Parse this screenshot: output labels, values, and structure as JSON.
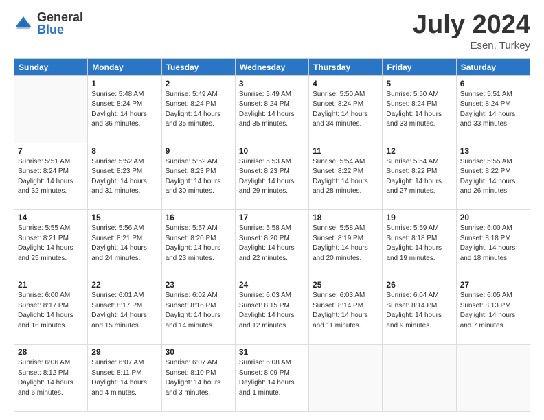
{
  "logo": {
    "general": "General",
    "blue": "Blue"
  },
  "title": "July 2024",
  "subtitle": "Esen, Turkey",
  "weekdays": [
    "Sunday",
    "Monday",
    "Tuesday",
    "Wednesday",
    "Thursday",
    "Friday",
    "Saturday"
  ],
  "weeks": [
    [
      {
        "day": null
      },
      {
        "day": "1",
        "sunrise": "5:48 AM",
        "sunset": "8:24 PM",
        "daylight": "14 hours and 36 minutes."
      },
      {
        "day": "2",
        "sunrise": "5:49 AM",
        "sunset": "8:24 PM",
        "daylight": "14 hours and 35 minutes."
      },
      {
        "day": "3",
        "sunrise": "5:49 AM",
        "sunset": "8:24 PM",
        "daylight": "14 hours and 35 minutes."
      },
      {
        "day": "4",
        "sunrise": "5:50 AM",
        "sunset": "8:24 PM",
        "daylight": "14 hours and 34 minutes."
      },
      {
        "day": "5",
        "sunrise": "5:50 AM",
        "sunset": "8:24 PM",
        "daylight": "14 hours and 33 minutes."
      },
      {
        "day": "6",
        "sunrise": "5:51 AM",
        "sunset": "8:24 PM",
        "daylight": "14 hours and 33 minutes."
      }
    ],
    [
      {
        "day": "7",
        "sunrise": "5:51 AM",
        "sunset": "8:24 PM",
        "daylight": "14 hours and 32 minutes."
      },
      {
        "day": "8",
        "sunrise": "5:52 AM",
        "sunset": "8:23 PM",
        "daylight": "14 hours and 31 minutes."
      },
      {
        "day": "9",
        "sunrise": "5:52 AM",
        "sunset": "8:23 PM",
        "daylight": "14 hours and 30 minutes."
      },
      {
        "day": "10",
        "sunrise": "5:53 AM",
        "sunset": "8:23 PM",
        "daylight": "14 hours and 29 minutes."
      },
      {
        "day": "11",
        "sunrise": "5:54 AM",
        "sunset": "8:22 PM",
        "daylight": "14 hours and 28 minutes."
      },
      {
        "day": "12",
        "sunrise": "5:54 AM",
        "sunset": "8:22 PM",
        "daylight": "14 hours and 27 minutes."
      },
      {
        "day": "13",
        "sunrise": "5:55 AM",
        "sunset": "8:22 PM",
        "daylight": "14 hours and 26 minutes."
      }
    ],
    [
      {
        "day": "14",
        "sunrise": "5:55 AM",
        "sunset": "8:21 PM",
        "daylight": "14 hours and 25 minutes."
      },
      {
        "day": "15",
        "sunrise": "5:56 AM",
        "sunset": "8:21 PM",
        "daylight": "14 hours and 24 minutes."
      },
      {
        "day": "16",
        "sunrise": "5:57 AM",
        "sunset": "8:20 PM",
        "daylight": "14 hours and 23 minutes."
      },
      {
        "day": "17",
        "sunrise": "5:58 AM",
        "sunset": "8:20 PM",
        "daylight": "14 hours and 22 minutes."
      },
      {
        "day": "18",
        "sunrise": "5:58 AM",
        "sunset": "8:19 PM",
        "daylight": "14 hours and 20 minutes."
      },
      {
        "day": "19",
        "sunrise": "5:59 AM",
        "sunset": "8:18 PM",
        "daylight": "14 hours and 19 minutes."
      },
      {
        "day": "20",
        "sunrise": "6:00 AM",
        "sunset": "8:18 PM",
        "daylight": "14 hours and 18 minutes."
      }
    ],
    [
      {
        "day": "21",
        "sunrise": "6:00 AM",
        "sunset": "8:17 PM",
        "daylight": "14 hours and 16 minutes."
      },
      {
        "day": "22",
        "sunrise": "6:01 AM",
        "sunset": "8:17 PM",
        "daylight": "14 hours and 15 minutes."
      },
      {
        "day": "23",
        "sunrise": "6:02 AM",
        "sunset": "8:16 PM",
        "daylight": "14 hours and 14 minutes."
      },
      {
        "day": "24",
        "sunrise": "6:03 AM",
        "sunset": "8:15 PM",
        "daylight": "14 hours and 12 minutes."
      },
      {
        "day": "25",
        "sunrise": "6:03 AM",
        "sunset": "8:14 PM",
        "daylight": "14 hours and 11 minutes."
      },
      {
        "day": "26",
        "sunrise": "6:04 AM",
        "sunset": "8:14 PM",
        "daylight": "14 hours and 9 minutes."
      },
      {
        "day": "27",
        "sunrise": "6:05 AM",
        "sunset": "8:13 PM",
        "daylight": "14 hours and 7 minutes."
      }
    ],
    [
      {
        "day": "28",
        "sunrise": "6:06 AM",
        "sunset": "8:12 PM",
        "daylight": "14 hours and 6 minutes."
      },
      {
        "day": "29",
        "sunrise": "6:07 AM",
        "sunset": "8:11 PM",
        "daylight": "14 hours and 4 minutes."
      },
      {
        "day": "30",
        "sunrise": "6:07 AM",
        "sunset": "8:10 PM",
        "daylight": "14 hours and 3 minutes."
      },
      {
        "day": "31",
        "sunrise": "6:08 AM",
        "sunset": "8:09 PM",
        "daylight": "14 hours and 1 minute."
      },
      {
        "day": null
      },
      {
        "day": null
      },
      {
        "day": null
      }
    ]
  ]
}
